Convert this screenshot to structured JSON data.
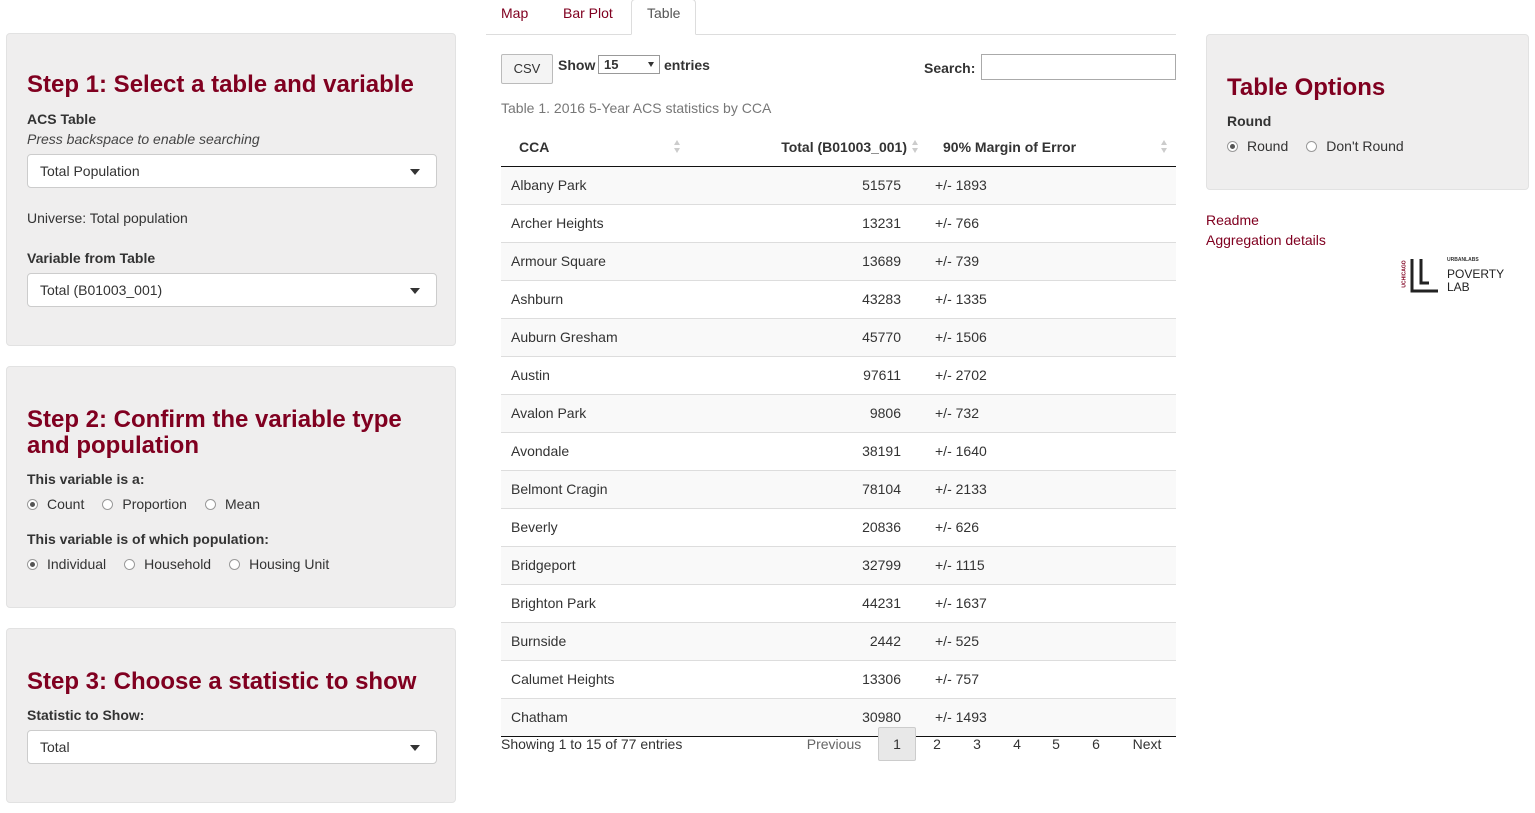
{
  "tabs": [
    "Map",
    "Bar Plot",
    "Table"
  ],
  "step1": {
    "title": "Step 1: Select a table and variable",
    "acs_label": "ACS Table",
    "acs_hint": "Press backspace to enable searching",
    "acs_value": "Total Population",
    "universe": "Universe: Total population",
    "var_label": "Variable from Table",
    "var_value": "Total (B01003_001)"
  },
  "step2": {
    "title": "Step 2: Confirm the variable type and population",
    "type_label": "This variable is a:",
    "type_options": [
      "Count",
      "Proportion",
      "Mean"
    ],
    "type_selected": "Count",
    "pop_label": "This variable is of which population:",
    "pop_options": [
      "Individual",
      "Household",
      "Housing Unit"
    ],
    "pop_selected": "Individual"
  },
  "step3": {
    "title": "Step 3: Choose a statistic to show",
    "stat_label": "Statistic to Show:",
    "stat_value": "Total"
  },
  "table_controls": {
    "csv": "CSV",
    "show": "Show",
    "entries_value": "15",
    "entries": "entries",
    "search": "Search:",
    "caption": "Table 1. 2016 5-Year ACS statistics by CCA"
  },
  "table": {
    "headers": [
      "CCA",
      "Total (B01003_001)",
      "90% Margin of Error"
    ],
    "rows": [
      [
        "Albany Park",
        "51575",
        "+/- 1893"
      ],
      [
        "Archer Heights",
        "13231",
        "+/- 766"
      ],
      [
        "Armour Square",
        "13689",
        "+/- 739"
      ],
      [
        "Ashburn",
        "43283",
        "+/- 1335"
      ],
      [
        "Auburn Gresham",
        "45770",
        "+/- 1506"
      ],
      [
        "Austin",
        "97611",
        "+/- 2702"
      ],
      [
        "Avalon Park",
        "9806",
        "+/- 732"
      ],
      [
        "Avondale",
        "38191",
        "+/- 1640"
      ],
      [
        "Belmont Cragin",
        "78104",
        "+/- 2133"
      ],
      [
        "Beverly",
        "20836",
        "+/- 626"
      ],
      [
        "Bridgeport",
        "32799",
        "+/- 1115"
      ],
      [
        "Brighton Park",
        "44231",
        "+/- 1637"
      ],
      [
        "Burnside",
        "2442",
        "+/- 525"
      ],
      [
        "Calumet Heights",
        "13306",
        "+/- 757"
      ],
      [
        "Chatham",
        "30980",
        "+/- 1493"
      ]
    ],
    "info": "Showing 1 to 15 of 77 entries"
  },
  "pagination": {
    "previous": "Previous",
    "pages": [
      "1",
      "2",
      "3",
      "4",
      "5",
      "6"
    ],
    "current": "1",
    "next": "Next"
  },
  "options": {
    "title": "Table Options",
    "round_label": "Round",
    "round_options": [
      "Round",
      "Don't Round"
    ],
    "round_selected": "Round"
  },
  "links": [
    "Readme",
    "Aggregation details"
  ],
  "logo": {
    "side": "UCHICAGO",
    "top": "URBANLABS",
    "line1": "POVERTY",
    "line2": "LAB"
  }
}
